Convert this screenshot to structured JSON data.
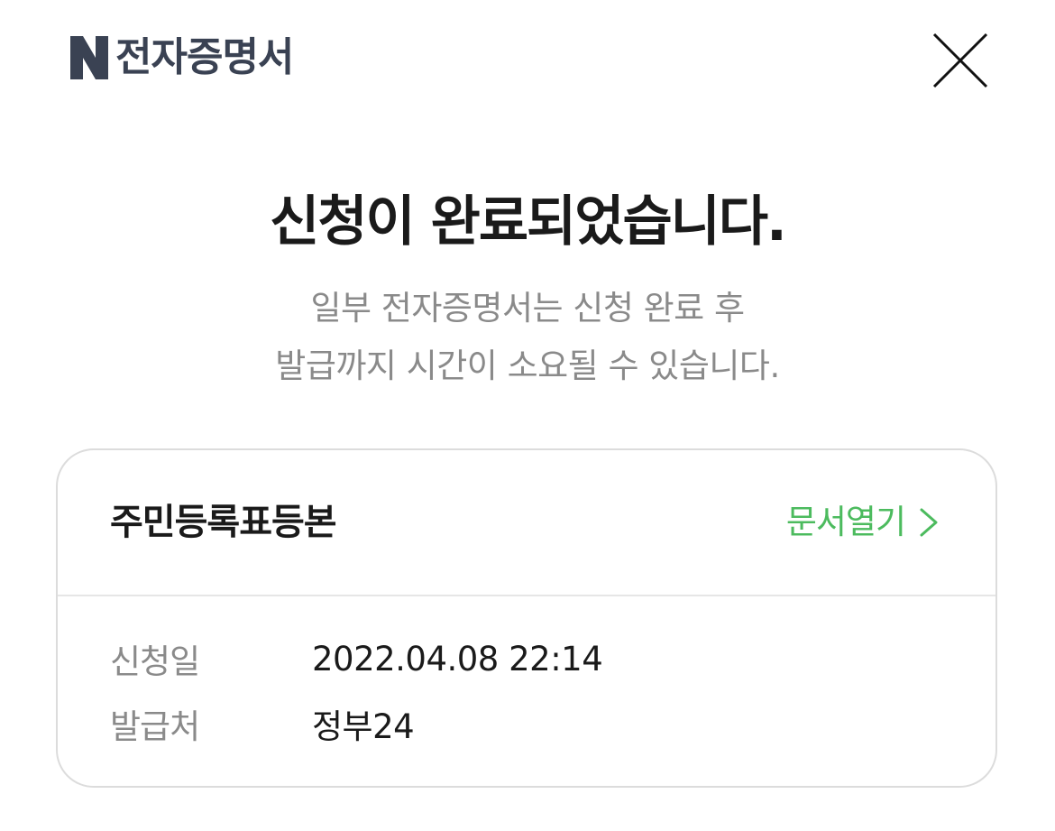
{
  "header": {
    "logo_icon": "naver-n-logo-icon",
    "title": "전자증명서",
    "close_icon": "close-icon"
  },
  "completion": {
    "headline": "신청이 완료되었습니다.",
    "subtext_line1": "일부 전자증명서는 신청 완료 후",
    "subtext_line2": "발급까지 시간이 소요될 수 있습니다."
  },
  "document_card": {
    "title": "주민등록표등본",
    "open_label": "문서열기",
    "open_icon": "chevron-right-icon",
    "details": [
      {
        "label": "신청일",
        "value": "2022.04.08 22:14"
      },
      {
        "label": "발급처",
        "value": "정부24"
      }
    ]
  },
  "colors": {
    "brand_text": "#3a4253",
    "accent_green": "#4cbb5e",
    "muted_text": "#8a8a8a",
    "primary_text": "#1a1a1a",
    "card_border": "#dcdcdc"
  }
}
